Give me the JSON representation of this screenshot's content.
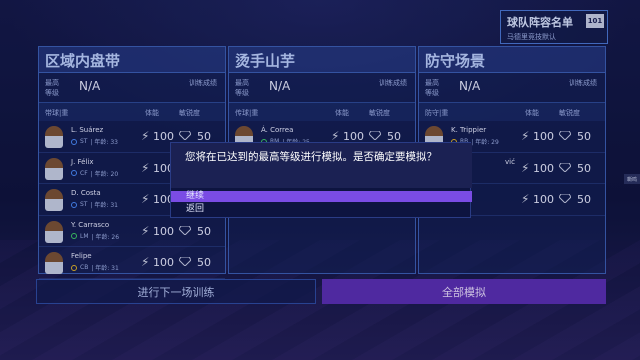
{
  "squad_badge": {
    "title": "球队阵容名单",
    "subtitle": "马德里竞技默认",
    "number": "101"
  },
  "panels": [
    {
      "title": "区域内盘带",
      "level_label": "最高\n等级",
      "level_value": "N/A",
      "training_label": "训练成绩",
      "col_player": "带球|重",
      "col_stamina": "体能",
      "col_sharpness": "敏锐度",
      "players": [
        {
          "name": "L. Suárez",
          "pos": "ST",
          "age": "| 年龄: 33",
          "dot": "b",
          "stamina": "100",
          "sharpness": "50"
        },
        {
          "name": "J. Félix",
          "pos": "CF",
          "age": "| 年龄: 20",
          "dot": "b",
          "stamina": "100",
          "sharpness": "50"
        },
        {
          "name": "D. Costa",
          "pos": "ST",
          "age": "| 年龄: 31",
          "dot": "b",
          "stamina": "100",
          "sharpness": "50"
        },
        {
          "name": "Y. Carrasco",
          "pos": "LM",
          "age": "| 年龄: 26",
          "dot": "g",
          "stamina": "100",
          "sharpness": "50"
        },
        {
          "name": "Felipe",
          "pos": "CB",
          "age": "| 年龄: 31",
          "dot": "y",
          "stamina": "100",
          "sharpness": "50"
        }
      ]
    },
    {
      "title": "烫手山芋",
      "level_label": "最高\n等级",
      "level_value": "N/A",
      "training_label": "训练成绩",
      "col_player": "传球|重",
      "col_stamina": "体能",
      "col_sharpness": "敏锐度",
      "players": [
        {
          "name": "Á. Correa",
          "pos": "RM",
          "age": "| 年龄: 25",
          "dot": "g",
          "stamina": "100",
          "sharpness": "50"
        }
      ]
    },
    {
      "title": "防守场景",
      "level_label": "最高\n等级",
      "level_value": "N/A",
      "training_label": "训练成绩",
      "col_player": "防守|重",
      "col_stamina": "体能",
      "col_sharpness": "敏锐度",
      "players": [
        {
          "name": "K. Trippier",
          "pos": "RB",
          "age": "| 年龄: 29",
          "dot": "y",
          "stamina": "100",
          "sharpness": "50"
        },
        {
          "name": "vić",
          "pos": "",
          "age": "",
          "dot": "",
          "stamina": "100",
          "sharpness": "50"
        },
        {
          "name": "",
          "pos": "",
          "age": "",
          "dot": "",
          "stamina": "100",
          "sharpness": "50"
        }
      ]
    }
  ],
  "buttons": {
    "next_training": "进行下一场训练",
    "simulate_all": "全部模拟"
  },
  "side_tab": "嘶鸣",
  "modal": {
    "message": "您将在已达到的最高等级进行模拟。是否确定要模拟？",
    "option_continue": "继续",
    "option_back": "返回"
  },
  "colors": {
    "accent_purple": "#5b2fb7",
    "selected_option": "#7a4ce4",
    "panel_border": "#3c5fb8"
  }
}
